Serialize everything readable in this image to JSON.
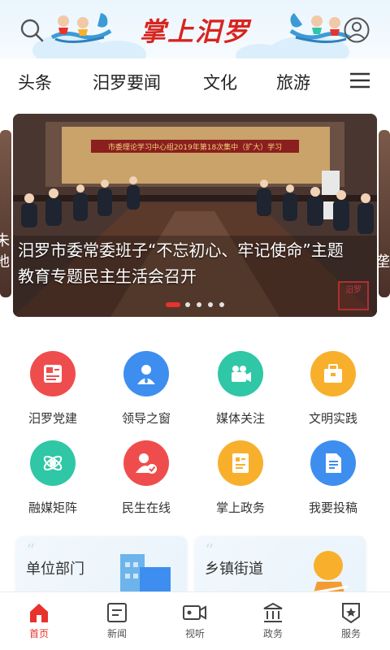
{
  "header": {
    "title": "掌上汨罗"
  },
  "nav": {
    "tabs": [
      "头条",
      "汨罗要闻",
      "文化",
      "旅游"
    ]
  },
  "carousel": {
    "caption": "汨罗市委常委班子“不忘初心、牢记使命”主题教育专题民主生活会召开",
    "banner_slogan": "市委理论学习中心组2019年第18次集中（扩大）学习",
    "stamp_text": "汨罗",
    "left_peek_text": "朱\n地",
    "right_peek_text": "垄",
    "slide_count": 5,
    "active_index": 0
  },
  "grid": {
    "items": [
      {
        "label": "汨罗党建",
        "icon": "party-flag-icon",
        "color": "#ef4d4d"
      },
      {
        "label": "领导之窗",
        "icon": "leader-person-icon",
        "color": "#3e8ef0"
      },
      {
        "label": "媒体关注",
        "icon": "video-camera-icon",
        "color": "#2fc7a6"
      },
      {
        "label": "文明实践",
        "icon": "briefcase-icon",
        "color": "#f8b02c"
      },
      {
        "label": "融媒矩阵",
        "icon": "orbit-icon",
        "color": "#2fc7a6"
      },
      {
        "label": "民生在线",
        "icon": "user-check-icon",
        "color": "#ef4d4d"
      },
      {
        "label": "掌上政务",
        "icon": "document-list-icon",
        "color": "#f8b02c"
      },
      {
        "label": "我要投稿",
        "icon": "edit-document-icon",
        "color": "#3e8ef0"
      }
    ]
  },
  "cards": {
    "left_title": "单位部门",
    "right_title": "乡镇街道"
  },
  "tabbar": {
    "tabs": [
      {
        "label": "首页",
        "icon": "home-icon"
      },
      {
        "label": "新闻",
        "icon": "news-icon"
      },
      {
        "label": "视听",
        "icon": "video-icon"
      },
      {
        "label": "政务",
        "icon": "government-icon"
      },
      {
        "label": "服务",
        "icon": "service-icon"
      }
    ],
    "active_index": 0
  },
  "colors": {
    "accent": "#e8322c",
    "header_bg": "#eaf5fd"
  }
}
